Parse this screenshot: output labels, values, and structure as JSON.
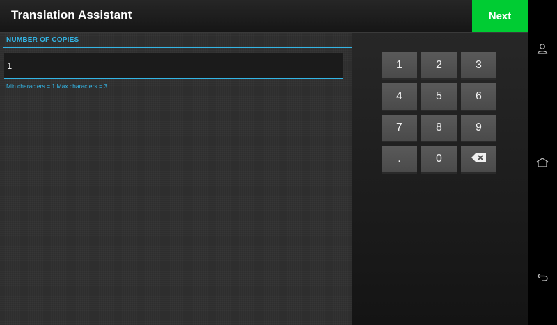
{
  "header": {
    "title": "Translation Assistant",
    "next_label": "Next"
  },
  "form": {
    "section_label": "NUMBER OF COPIES",
    "input_value": "1",
    "hint": "Min characters = 1 Max characters = 3"
  },
  "keypad": {
    "keys": [
      {
        "label": "1"
      },
      {
        "label": "2"
      },
      {
        "label": "3"
      },
      {
        "label": "4"
      },
      {
        "label": "5"
      },
      {
        "label": "6"
      },
      {
        "label": "7"
      },
      {
        "label": "8"
      },
      {
        "label": "9"
      },
      {
        "label": "."
      },
      {
        "label": "0"
      },
      {
        "icon": "backspace-icon"
      }
    ]
  },
  "system_nav": {
    "buttons": [
      "user-icon",
      "home-icon",
      "back-icon"
    ]
  },
  "colors": {
    "accent": "#33b5e5",
    "next_button": "#00cc33"
  }
}
